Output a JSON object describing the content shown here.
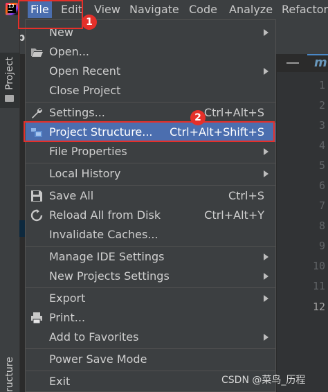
{
  "menubar": {
    "items": [
      "File",
      "Edit",
      "View",
      "Navigate",
      "Code",
      "Analyze",
      "Refactor"
    ],
    "active": "File"
  },
  "left_tabs": {
    "top": "Project",
    "bottom": "ructure"
  },
  "project_bar": {
    "label": "app"
  },
  "editor": {
    "tab_text": "m",
    "line_numbers": [
      "1",
      "2",
      "3",
      "4",
      "5",
      "6",
      "7",
      "8",
      "9",
      "10",
      "11",
      "12"
    ],
    "current_line": "12"
  },
  "file_menu": {
    "items": [
      {
        "label": "New",
        "shortcut": "",
        "submenu": true,
        "icon": ""
      },
      {
        "label": "Open...",
        "shortcut": "",
        "submenu": false,
        "icon": "folder-open-icon"
      },
      {
        "label": "Open Recent",
        "shortcut": "",
        "submenu": true,
        "icon": ""
      },
      {
        "label": "Close Project",
        "shortcut": "",
        "submenu": false,
        "icon": ""
      },
      {
        "label": "Settings...",
        "shortcut": "Ctrl+Alt+S",
        "submenu": false,
        "icon": "wrench-icon"
      },
      {
        "label": "Project Structure...",
        "shortcut": "Ctrl+Alt+Shift+S",
        "submenu": false,
        "icon": "project-structure-icon",
        "selected": true
      },
      {
        "label": "File Properties",
        "shortcut": "",
        "submenu": true,
        "icon": ""
      },
      {
        "label": "Local History",
        "shortcut": "",
        "submenu": true,
        "icon": ""
      },
      {
        "label": "Save All",
        "shortcut": "Ctrl+S",
        "submenu": false,
        "icon": "save-icon"
      },
      {
        "label": "Reload All from Disk",
        "shortcut": "Ctrl+Alt+Y",
        "submenu": false,
        "icon": "reload-icon"
      },
      {
        "label": "Invalidate Caches...",
        "shortcut": "",
        "submenu": false,
        "icon": ""
      },
      {
        "label": "Manage IDE Settings",
        "shortcut": "",
        "submenu": true,
        "icon": ""
      },
      {
        "label": "New Projects Settings",
        "shortcut": "",
        "submenu": true,
        "icon": ""
      },
      {
        "label": "Export",
        "shortcut": "",
        "submenu": true,
        "icon": ""
      },
      {
        "label": "Print...",
        "shortcut": "",
        "submenu": false,
        "icon": "printer-icon"
      },
      {
        "label": "Add to Favorites",
        "shortcut": "",
        "submenu": true,
        "icon": ""
      },
      {
        "label": "Power Save Mode",
        "shortcut": "",
        "submenu": false,
        "icon": ""
      },
      {
        "label": "Exit",
        "shortcut": "",
        "submenu": false,
        "icon": ""
      }
    ]
  },
  "annotations": {
    "step1": "1",
    "step2": "2"
  },
  "watermark": "CSDN @菜鸟_历程",
  "colors": {
    "menubar": "#3c3f41",
    "selection": "#4b6eaf",
    "annotation": "#e5302a",
    "editor": "#2b2b2b"
  }
}
